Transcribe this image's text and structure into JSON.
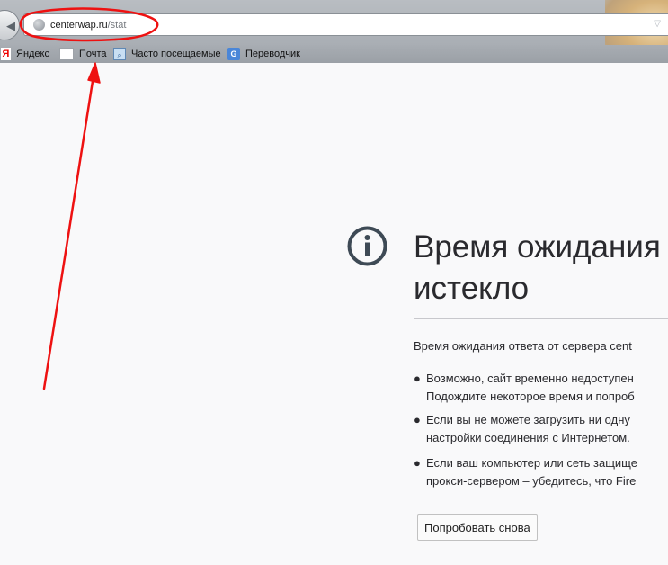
{
  "browser": {
    "url_host": "centerwap.ru",
    "url_path": "/stat",
    "bookmarks": [
      {
        "icon": "yandex-icon",
        "label": "Яндекс"
      },
      {
        "icon": "mail-icon",
        "label": "Почта"
      },
      {
        "icon": "frequent-icon",
        "label": "Часто посещаемые"
      },
      {
        "icon": "translate-icon",
        "label": "Переводчик"
      }
    ]
  },
  "error": {
    "icon": "info-icon",
    "title_line1": "Время ожидания",
    "title_line2": "истекло",
    "description": "Время ожидания ответа от сервера cent",
    "suggestions": [
      {
        "line1": "Возможно, сайт временно недоступен",
        "line2": "Подождите некоторое время и попроб"
      },
      {
        "line1": "Если вы не можете загрузить ни одну",
        "line2": "настройки соединения с Интернетом."
      },
      {
        "line1": "Если ваш компьютер или сеть защище",
        "line2": "прокси-сервером – убедитесь, что Fire"
      }
    ],
    "try_again_label": "Попробовать снова"
  },
  "annotation": {
    "color": "#ee1111"
  }
}
